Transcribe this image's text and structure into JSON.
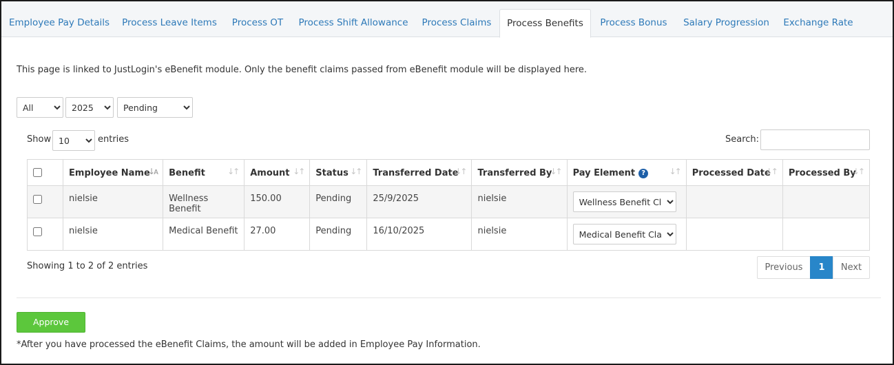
{
  "tabs": [
    {
      "label": "Employee Pay Details"
    },
    {
      "label": "Process Leave Items"
    },
    {
      "label": "Process OT"
    },
    {
      "label": "Process Shift Allowance"
    },
    {
      "label": "Process Claims"
    },
    {
      "label": "Process Benefits",
      "active": true
    },
    {
      "label": "Process Bonus"
    },
    {
      "label": "Salary Progression"
    },
    {
      "label": "Exchange Rate"
    }
  ],
  "info_text": "This page is linked to JustLogin's eBenefit module. Only the benefit claims passed from eBenefit module will be displayed here.",
  "filters": {
    "scope": "All",
    "year": "2025",
    "status": "Pending"
  },
  "table_controls": {
    "show_label": "Show",
    "entries_value": "10",
    "entries_label": "entries",
    "search_label": "Search:",
    "search_value": ""
  },
  "columns": [
    "Employee Name",
    "Benefit",
    "Amount",
    "Status",
    "Transferred Date",
    "Transferred By",
    "Pay Element",
    "Processed Date",
    "Processed By"
  ],
  "rows": [
    {
      "employee": "nielsie",
      "benefit": "Wellness Benefit",
      "amount": "150.00",
      "status": "Pending",
      "transferred_date": "25/9/2025",
      "transferred_by": "nielsie",
      "pay_element": "Wellness Benefit Cl",
      "processed_date": "",
      "processed_by": ""
    },
    {
      "employee": "nielsie",
      "benefit": "Medical Benefit",
      "amount": "27.00",
      "status": "Pending",
      "transferred_date": "16/10/2025",
      "transferred_by": "nielsie",
      "pay_element": "Medical Benefit Cla",
      "processed_date": "",
      "processed_by": ""
    }
  ],
  "footer": {
    "showing_text": "Showing 1 to 2 of 2 entries",
    "previous": "Previous",
    "page": "1",
    "next": "Next"
  },
  "approve_label": "Approve",
  "note_text": "*After you have processed the eBenefit Claims, the amount will be added in Employee Pay Information.",
  "colors": {
    "link": "#2d79b8",
    "approve": "#5cc73c",
    "pager_active": "#2886c9",
    "help_icon": "#1d5fa8"
  },
  "icons": {
    "sort": "sort-arrows-icon",
    "sort_active": "sort-alpha-down-icon",
    "help": "question-circle-icon"
  }
}
